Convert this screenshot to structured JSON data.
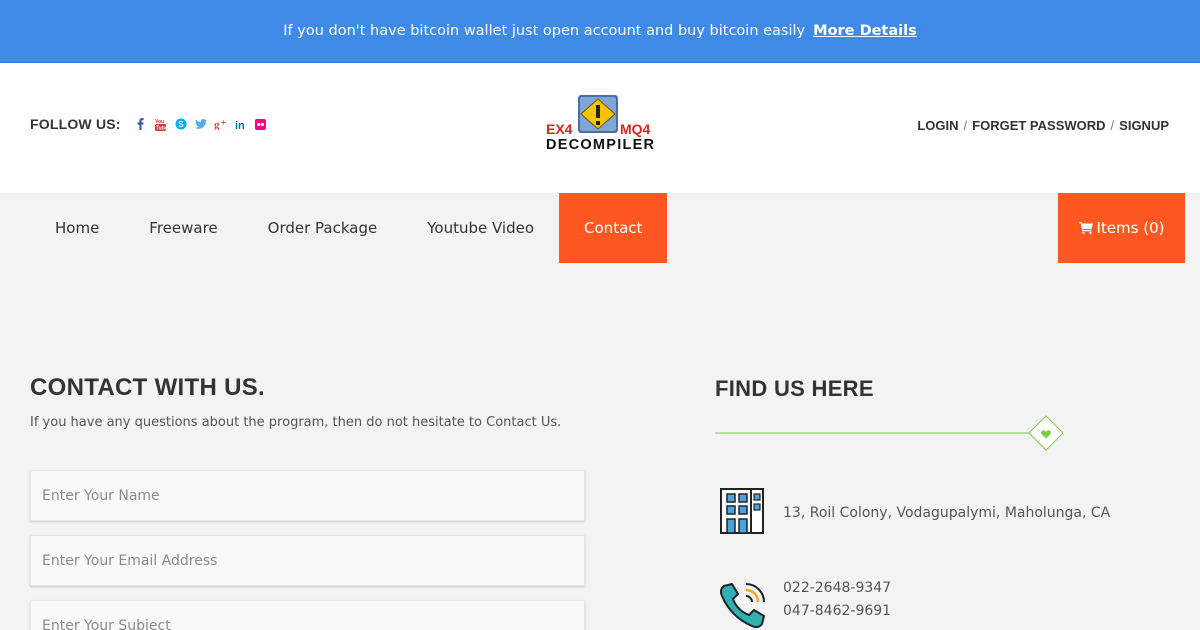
{
  "topbar": {
    "message": "If you don't have bitcoin wallet just open account and buy bitcoin easily",
    "link_label": "More Details"
  },
  "header": {
    "follow_label": "FOLLOW US:",
    "social_icons": [
      "facebook-icon",
      "youtube-icon",
      "skype-icon",
      "twitter-icon",
      "google-plus-icon",
      "linkedin-icon",
      "flickr-icon"
    ],
    "logo": {
      "line1_left": "EX4",
      "line1_right": "MQ4",
      "line2": "DECOMPILER"
    },
    "auth": {
      "login": "LOGIN",
      "forget_password": "FORGET PASSWORD",
      "signup": "SIGNUP",
      "separator": "/"
    }
  },
  "nav": {
    "items": [
      {
        "label": "Home"
      },
      {
        "label": "Freeware"
      },
      {
        "label": "Order Package"
      },
      {
        "label": "Youtube Video"
      },
      {
        "label": "Contact",
        "active": true
      }
    ],
    "cart_label": "Items (0)"
  },
  "contact": {
    "title": "CONTACT WITH US.",
    "subtitle": "If you have any questions about the program, then do not hesitate to Contact Us.",
    "name_placeholder": "Enter Your Name",
    "email_placeholder": "Enter Your Email Address",
    "subject_placeholder": "Enter Your Subject"
  },
  "find": {
    "title": "FIND US HERE",
    "address": "13, Roil Colony, Vodagupalymi, Maholunga, CA",
    "phone_1": "022-2648-9347",
    "phone_2": "047-8462-9691"
  },
  "colors": {
    "topbar": "#3f8ae7",
    "accent": "#ff5722",
    "divider_green": "#7ccc4a",
    "background": "#f3f3f3"
  }
}
